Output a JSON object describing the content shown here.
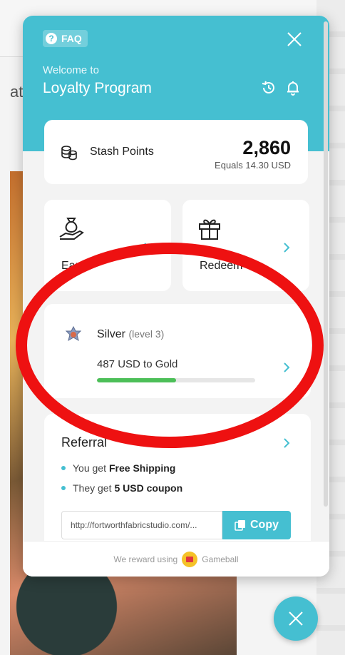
{
  "background": {
    "partial_text": "at"
  },
  "header": {
    "faq_label": "FAQ",
    "welcome": "Welcome to",
    "program_title": "Loyalty Program"
  },
  "points": {
    "label": "Stash Points",
    "value": "2,860",
    "equals": "Equals 14.30 USD"
  },
  "tiles": {
    "earn_label": "Earn",
    "redeem_label": "Redeem"
  },
  "tier": {
    "name": "Silver",
    "level": "(level 3)",
    "progress_text": "487 USD to Gold",
    "progress_fraction": 0.5
  },
  "referral": {
    "title": "Referral",
    "benefit_you_prefix": "You get",
    "benefit_you_value": "Free Shipping",
    "benefit_they_prefix": "They get",
    "benefit_they_value": "5 USD coupon",
    "link": "http://fortworthfabricstudio.com/...",
    "copy_label": "Copy"
  },
  "footer": {
    "prefix": "We reward using",
    "brand": "Gameball"
  },
  "colors": {
    "accent": "#45bfd1",
    "progress": "#4cbf58",
    "annotation": "#ee1111"
  },
  "icons": {
    "faq": "question-icon",
    "close": "close-icon",
    "history": "history-icon",
    "bell": "bell-icon",
    "points": "coins-icon",
    "earn": "money-bag-hand-icon",
    "redeem": "gift-icon",
    "tier": "tier-badge-icon",
    "copy": "copy-icon"
  }
}
